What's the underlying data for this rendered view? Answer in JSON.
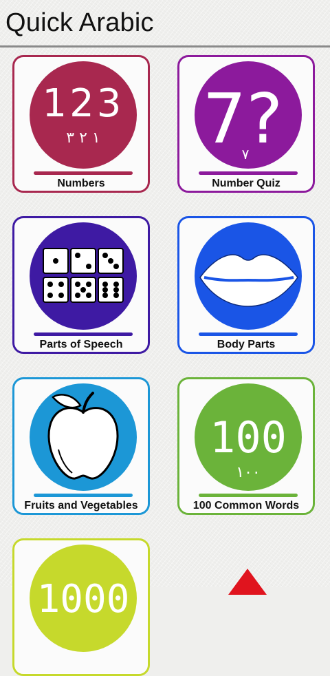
{
  "app": {
    "title": "Quick Arabic"
  },
  "tiles": [
    {
      "label": "Numbers",
      "icon": "numbers-123-icon",
      "color": "#a8284f",
      "circle_text": "123",
      "arabic_text": "١ ٢ ٣"
    },
    {
      "label": "Number Quiz",
      "icon": "number-quiz-icon",
      "color": "#8c1a9c",
      "circle_text": "7?",
      "arabic_text": "٧"
    },
    {
      "label": "Parts of Speech",
      "icon": "dice-icon",
      "color": "#3e1aa3"
    },
    {
      "label": "Body Parts",
      "icon": "lips-icon",
      "color": "#1a55e6"
    },
    {
      "label": "Fruits and Vegetables",
      "icon": "apple-icon",
      "color": "#1c97d6"
    },
    {
      "label": "100 Common Words",
      "icon": "hundred-icon",
      "color": "#6bb33a",
      "circle_text": "100",
      "arabic_text": "١٠٠"
    },
    {
      "label": "",
      "icon": "thousand-icon",
      "color": "#c6d92c",
      "circle_text": "1000"
    }
  ],
  "overflow_icon": {
    "name": "red-triangle-icon",
    "color": "#e0141e"
  }
}
